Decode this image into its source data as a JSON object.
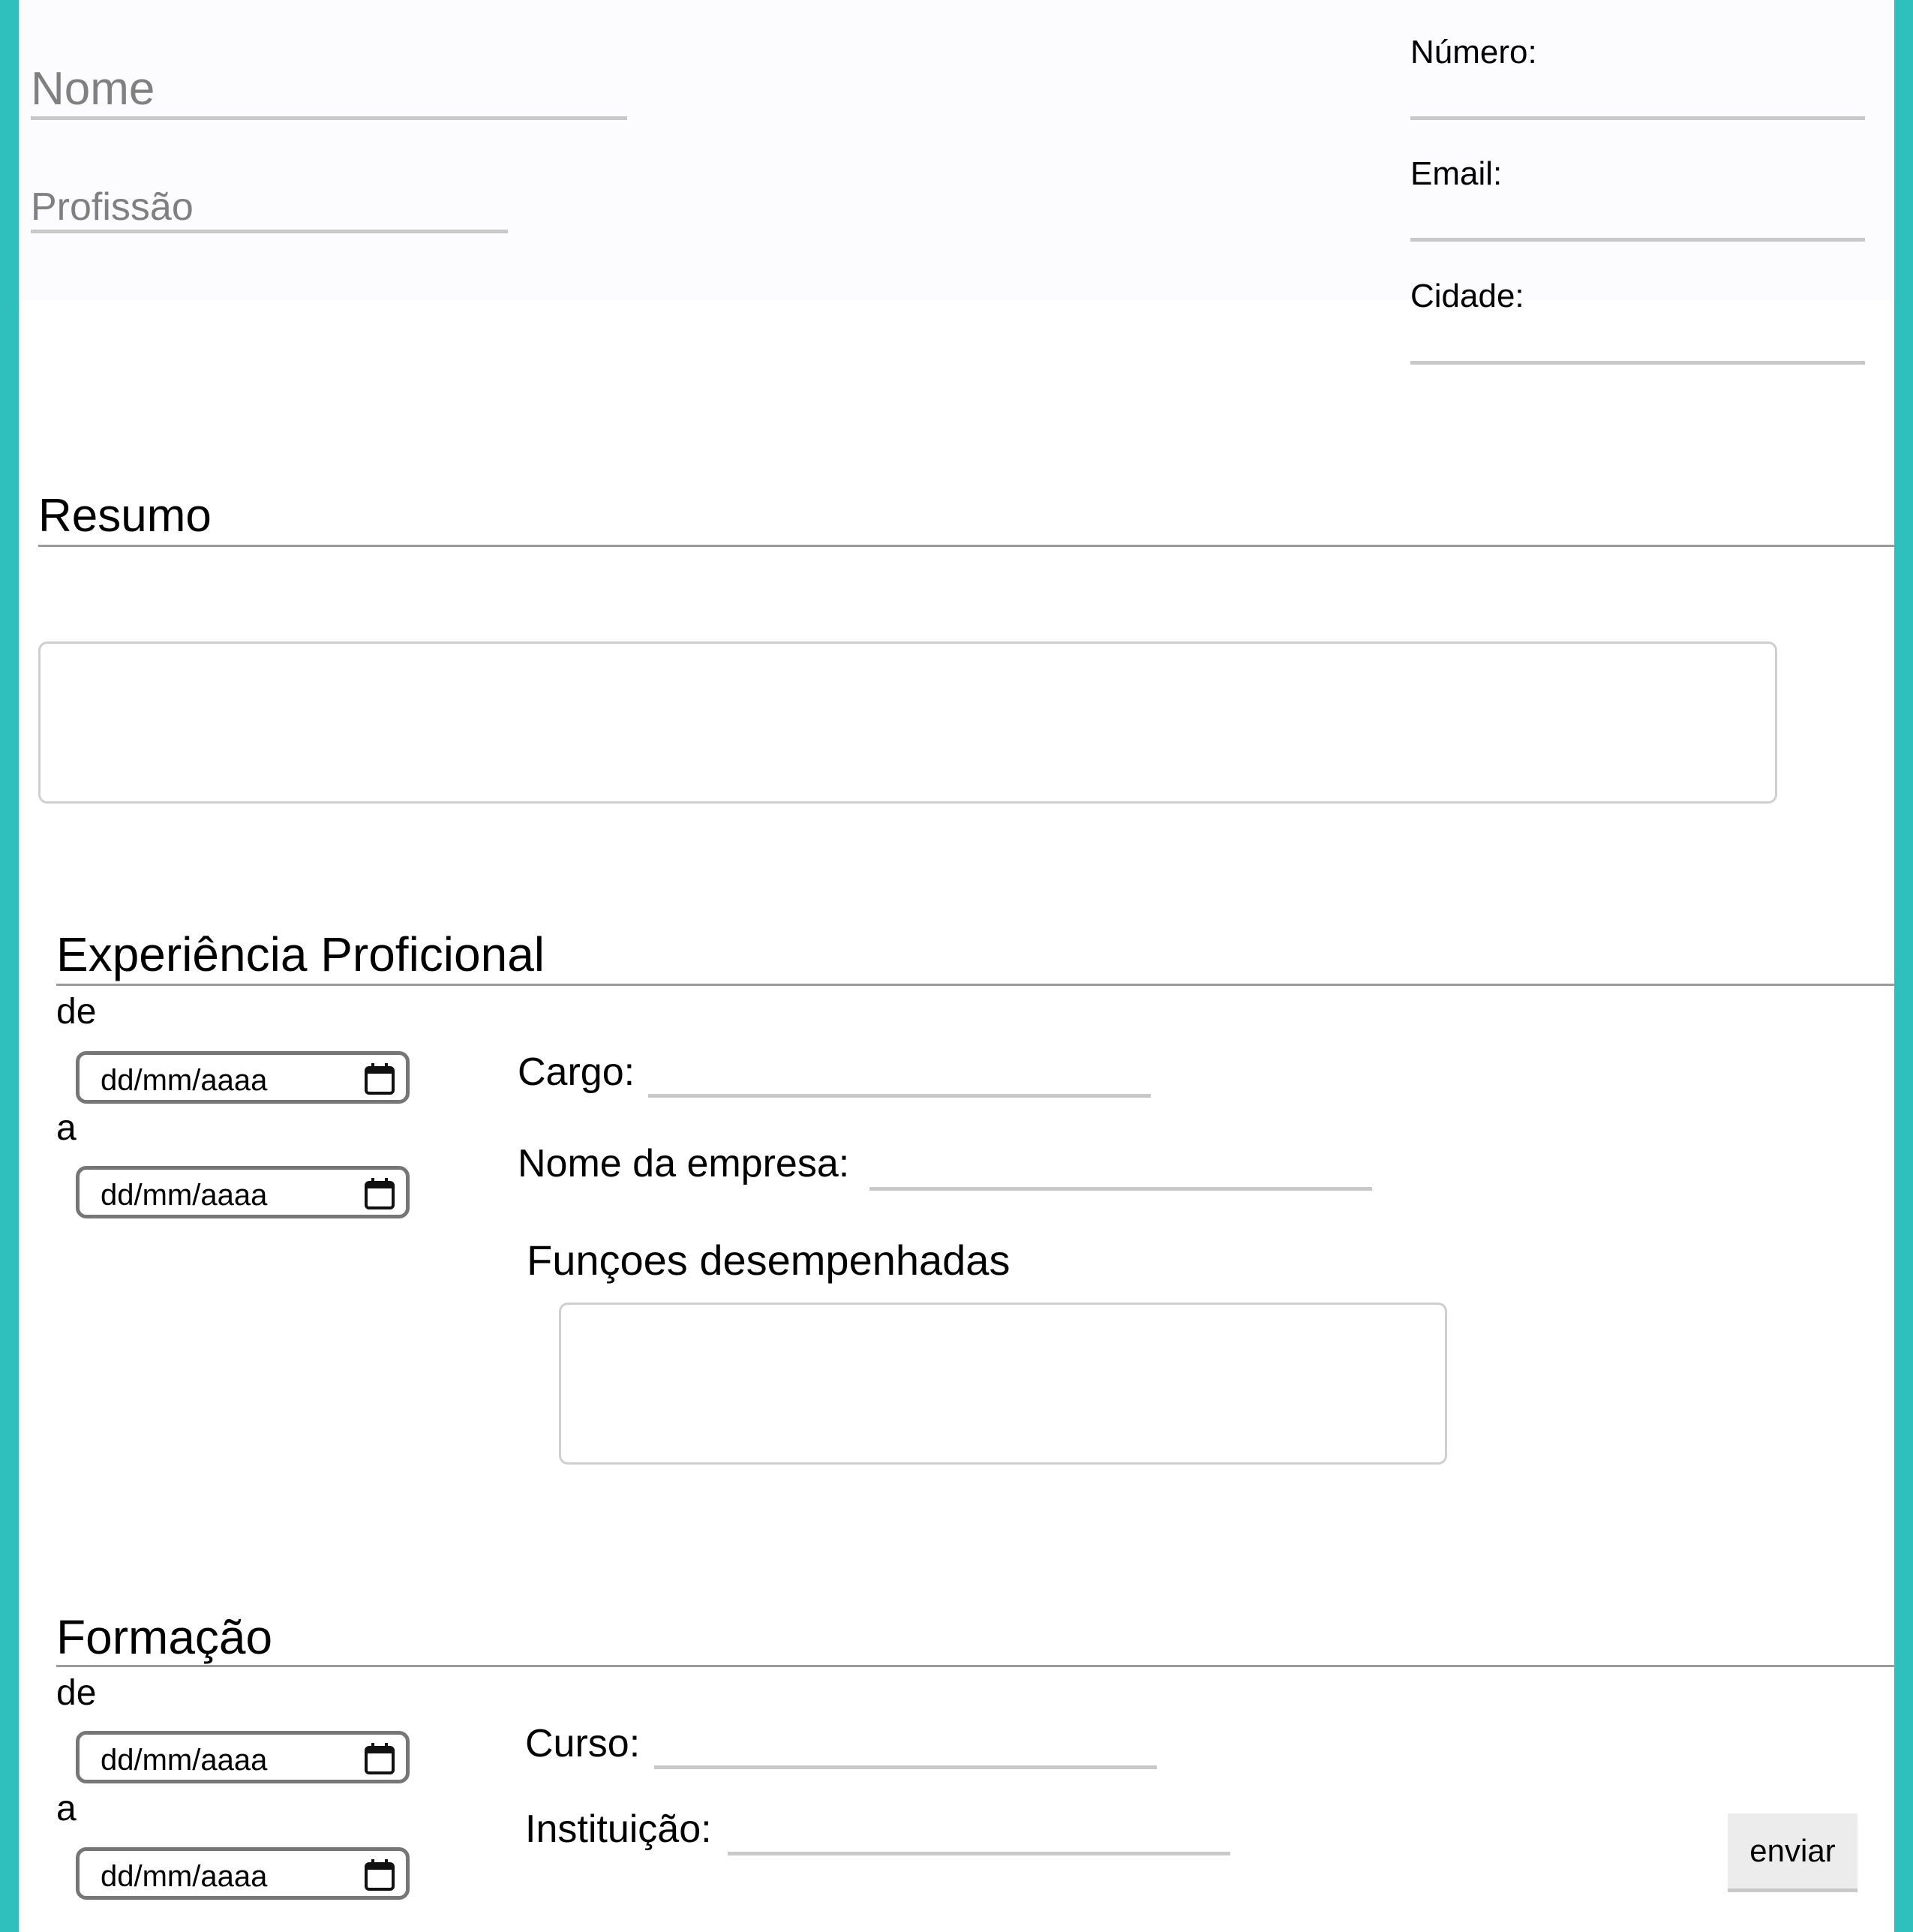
{
  "header": {
    "name_placeholder": "Nome",
    "profession_placeholder": "Profissão",
    "contacts": {
      "number_label": "Número:",
      "email_label": "Email:",
      "city_label": "Cidade:"
    }
  },
  "summary": {
    "title": "Resumo"
  },
  "experience": {
    "title": "Experiência Proficional",
    "from_label": "de",
    "to_label": "a",
    "date_placeholder": "dd/mm/aaaa",
    "role_label": "Cargo:",
    "company_label": "Nome da empresa:",
    "duties_label": "Funçoes desempenhadas"
  },
  "education": {
    "title": "Formação",
    "from_label": "de",
    "to_label": "a",
    "date_placeholder": "dd/mm/aaaa",
    "course_label": "Curso:",
    "institution_label": "Instituição:"
  },
  "actions": {
    "submit_label": "enviar"
  },
  "colors": {
    "border_accent": "#2fbfbd",
    "underline": "#c8c8c8",
    "placeholder": "#808080"
  },
  "icons": {
    "date_picker": "calendar-icon"
  }
}
